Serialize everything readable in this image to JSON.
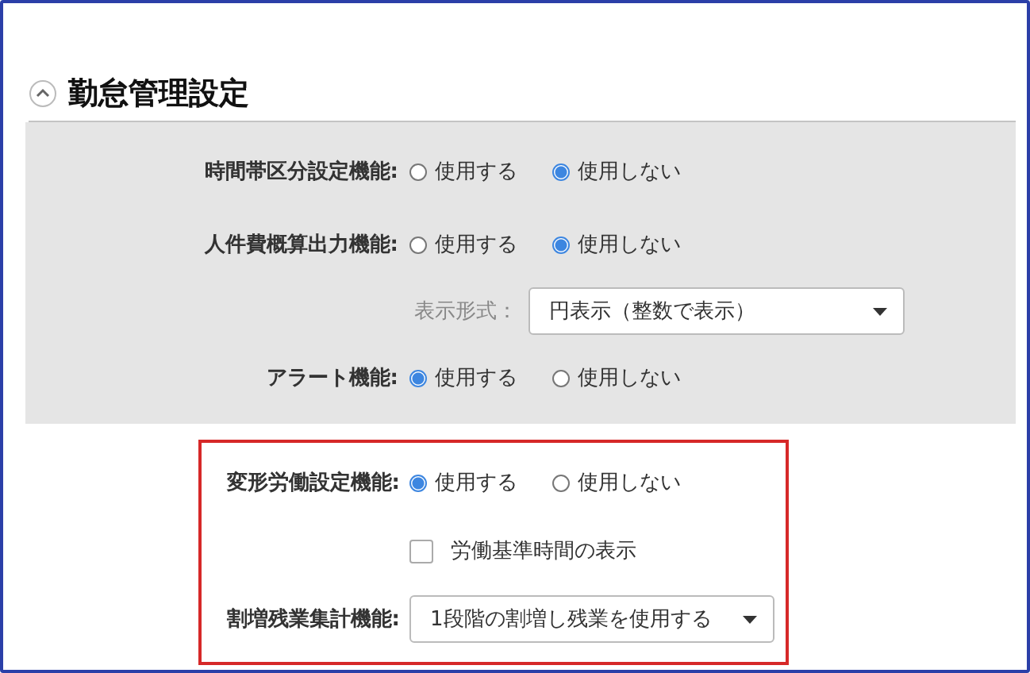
{
  "section": {
    "title": "勤怠管理設定",
    "expanded": true
  },
  "groups": [
    {
      "shaded": true,
      "highlighted": false,
      "rows": [
        {
          "kind": "radio",
          "label": "時間帯区分設定機能:",
          "options": [
            {
              "label": "使用する",
              "selected": false
            },
            {
              "label": "使用しない",
              "selected": true
            }
          ]
        },
        {
          "kind": "radio",
          "label": "人件費概算出力機能:",
          "options": [
            {
              "label": "使用する",
              "selected": false
            },
            {
              "label": "使用しない",
              "selected": true
            }
          ]
        },
        {
          "kind": "select",
          "label": "表示形式：",
          "disabled_label": true,
          "value": "円表示（整数で表示）"
        },
        {
          "kind": "radio",
          "label": "アラート機能:",
          "options": [
            {
              "label": "使用する",
              "selected": true
            },
            {
              "label": "使用しない",
              "selected": false
            }
          ]
        }
      ]
    },
    {
      "shaded": false,
      "highlighted": true,
      "rows": [
        {
          "kind": "radio",
          "label": "変形労働設定機能:",
          "options": [
            {
              "label": "使用する",
              "selected": true
            },
            {
              "label": "使用しない",
              "selected": false
            }
          ]
        },
        {
          "kind": "checkbox",
          "text": "労働基準時間の表示",
          "checked": false
        },
        {
          "kind": "select",
          "label": "割増残業集計機能:",
          "disabled_label": false,
          "value": "1段階の割増し残業を使用する"
        }
      ]
    }
  ]
}
